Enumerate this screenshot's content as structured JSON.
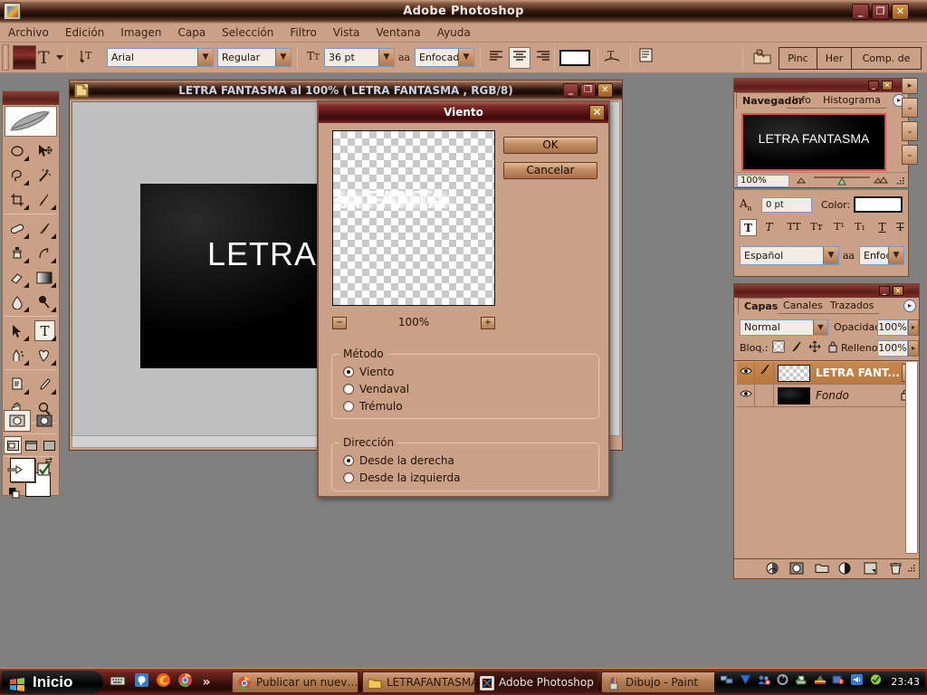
{
  "app": {
    "title": "Adobe Photoshop",
    "window_buttons": {
      "minimize": "_",
      "maximize": "❐",
      "close": "✕"
    }
  },
  "menubar": {
    "items": [
      "Archivo",
      "Edición",
      "Imagen",
      "Capa",
      "Selección",
      "Filtro",
      "Vista",
      "Ventana",
      "Ayuda"
    ]
  },
  "options_bar": {
    "tool_icon": "type-tool-icon",
    "tool_letter": "T",
    "orientation_icon": "text-orientation-icon",
    "font_family": "Arial",
    "font_style": "Regular",
    "font_size": "36 pt",
    "antialias_label": "aa",
    "antialias": "Enfocado",
    "align_left_icon": "align-left-icon",
    "align_center_icon": "align-center-icon",
    "align_right_icon": "align-right-icon",
    "color_swatch": "#ffffff",
    "warp_icon": "warp-text-icon",
    "palettes_icon": "character-palette-icon",
    "dock_icon": "palette-dock-icon",
    "palette_well": [
      "Pinc",
      "Her",
      "Comp. de capas"
    ]
  },
  "toolbox": {
    "tools": [
      [
        "marquee-tool",
        "move-tool"
      ],
      [
        "lasso-tool",
        "magic-wand-tool"
      ],
      [
        "crop-tool",
        "slice-tool"
      ],
      [
        "healing-brush-tool",
        "brush-tool"
      ],
      [
        "clone-stamp-tool",
        "history-brush-tool"
      ],
      [
        "eraser-tool",
        "gradient-tool"
      ],
      [
        "blur-tool",
        "dodge-tool"
      ],
      [
        "path-selection-tool",
        "type-tool"
      ],
      [
        "pen-tool",
        "custom-shape-tool"
      ],
      [
        "notes-tool",
        "eyedropper-tool"
      ],
      [
        "hand-tool",
        "zoom-tool"
      ]
    ],
    "selected_tool": "type-tool",
    "selected_tool_letter": "T",
    "foreground_color": "#ffffff",
    "background_color": "#ffffff",
    "default_colors_icon": "default-colors-icon",
    "swap_colors_icon": "swap-colors-icon",
    "quickmask_standard_icon": "standard-mode-icon",
    "quickmask_icon": "quick-mask-mode-icon",
    "screen_standard_icon": "standard-screen-icon",
    "screen_full_icon": "full-screen-icon",
    "screen_fullmenu_icon": "full-screen-menubar-icon",
    "jump_imageready_icon": "jump-to-imageready-icon",
    "jump_check_icon": "jump-check-icon"
  },
  "document_window": {
    "title": "LETRA FANTASMA al 100% ( LETRA FANTASMA , RGB/8)",
    "icon": "document-icon",
    "canvas_text": "LETRA",
    "window_buttons": {
      "minimize": "_",
      "maximize": "❐",
      "close": "✕"
    }
  },
  "dialog": {
    "title": "Viento",
    "close": "✕",
    "preview_text": "RA FANTA",
    "zoom_out": "−",
    "zoom_in": "+",
    "zoom_level": "100%",
    "ok_label": "OK",
    "cancel_label": "Cancelar",
    "method_group": {
      "label": "Método",
      "options": [
        {
          "label": "Viento",
          "selected": true
        },
        {
          "label": "Vendaval",
          "selected": false
        },
        {
          "label": "Trémulo",
          "selected": false
        }
      ]
    },
    "direction_group": {
      "label": "Dirección",
      "options": [
        {
          "label": "Desde la derecha",
          "selected": true
        },
        {
          "label": "Desde la izquierda",
          "selected": false
        }
      ]
    }
  },
  "navigator_panel": {
    "tabs": [
      "Navegador",
      "Info",
      "Histograma"
    ],
    "active_tab": "Navegador",
    "thumb_text": "LETRA FANTASMA",
    "zoom_value": "100%",
    "zoom_out_icon": "zoom-out-icon",
    "zoom_slider_icon": "zoom-slider-icon",
    "zoom_in_icon": "zoom-in-icon",
    "resize_icon": "resize-grip-icon",
    "menu_icon": "palette-menu-icon",
    "minimize": "_",
    "close": "✕"
  },
  "character_panel": {
    "baseline_icon": "baseline-shift-icon",
    "baseline_value": "0 pt",
    "color_label": "Color:",
    "color_value": "#ffffff",
    "styles": [
      {
        "name": "faux-bold",
        "glyph": "T",
        "on": true
      },
      {
        "name": "faux-italic",
        "glyph": "T",
        "on": false
      },
      {
        "name": "all-caps",
        "glyph": "TT",
        "on": false
      },
      {
        "name": "small-caps",
        "glyph": "Tт",
        "on": false
      },
      {
        "name": "superscript",
        "glyph": "T¹",
        "on": false
      },
      {
        "name": "subscript",
        "glyph": "T₁",
        "on": false
      },
      {
        "name": "underline",
        "glyph": "T",
        "on": false
      },
      {
        "name": "strikethrough",
        "glyph": "T",
        "on": false
      }
    ],
    "language": "Español",
    "antialias_label": "aa",
    "antialias": "Enfocado"
  },
  "layers_panel": {
    "tabs": [
      "Capas",
      "Canales",
      "Trazados"
    ],
    "active_tab": "Capas",
    "blend_mode": "Normal",
    "opacity_label": "Opacidad:",
    "opacity_value": "100%",
    "lock_label": "Bloq.:",
    "lock_icons": [
      "lock-transparency-icon",
      "lock-image-icon",
      "lock-position-icon",
      "lock-all-icon"
    ],
    "fill_label": "Relleno:",
    "fill_value": "100%",
    "layers": [
      {
        "name": "LETRA FANT...",
        "selected": true,
        "visible": true,
        "eye_icon": "eye-icon",
        "link_icon": "brush-icon",
        "thumb": "transparent",
        "locked": false
      },
      {
        "name": "Fondo",
        "selected": false,
        "visible": true,
        "eye_icon": "eye-icon",
        "link_icon": "",
        "thumb": "black",
        "locked": true,
        "lock_icon": "lock-icon"
      }
    ],
    "bottom_icons": [
      "layer-style-icon",
      "layer-mask-icon",
      "new-group-icon",
      "adjustment-layer-icon",
      "new-layer-icon",
      "delete-layer-icon"
    ],
    "menu_icon": "palette-menu-icon",
    "minimize": "_",
    "close": "✕"
  },
  "taskbar": {
    "start_label": "Inicio",
    "quick_launch": [
      "keyboard-icon",
      "messenger-icon",
      "firefox-icon",
      "chrome-icon"
    ],
    "overflow": "»",
    "tasks": [
      {
        "label": "Publicar un nuev…",
        "icon": "chrome-icon",
        "active": false
      },
      {
        "label": "LETRAFANTASMA",
        "icon": "folder-icon",
        "active": false
      },
      {
        "label": "Adobe Photoshop",
        "icon": "photoshop-icon",
        "active": true
      },
      {
        "label": "Dibujo - Paint",
        "icon": "paint-icon",
        "active": false
      }
    ],
    "tray_icons": [
      "network-icon",
      "antivirus-icon",
      "users-icon",
      "sync-icon",
      "printer-icon",
      "graphics-icon",
      "security-icon",
      "volume-icon",
      "shield-icon"
    ],
    "clock": "23:43"
  }
}
